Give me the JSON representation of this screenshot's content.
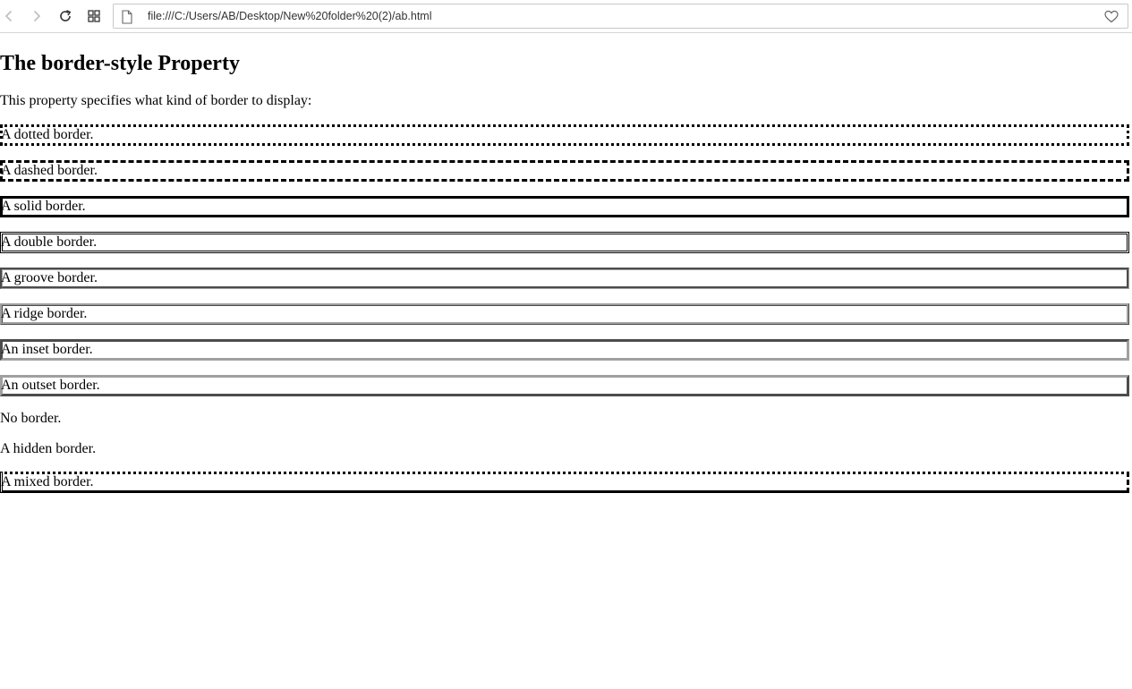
{
  "browser": {
    "url": "file:///C:/Users/AB/Desktop/New%20folder%20(2)/ab.html"
  },
  "page": {
    "title": "The border-style Property",
    "intro": "This property specifies what kind of border to display:",
    "paragraphs": [
      "A dotted border.",
      "A dashed border.",
      "A solid border.",
      "A double border.",
      "A groove border.",
      "A ridge border.",
      "An inset border.",
      "An outset border.",
      "No border.",
      "A hidden border.",
      "A mixed border."
    ]
  }
}
